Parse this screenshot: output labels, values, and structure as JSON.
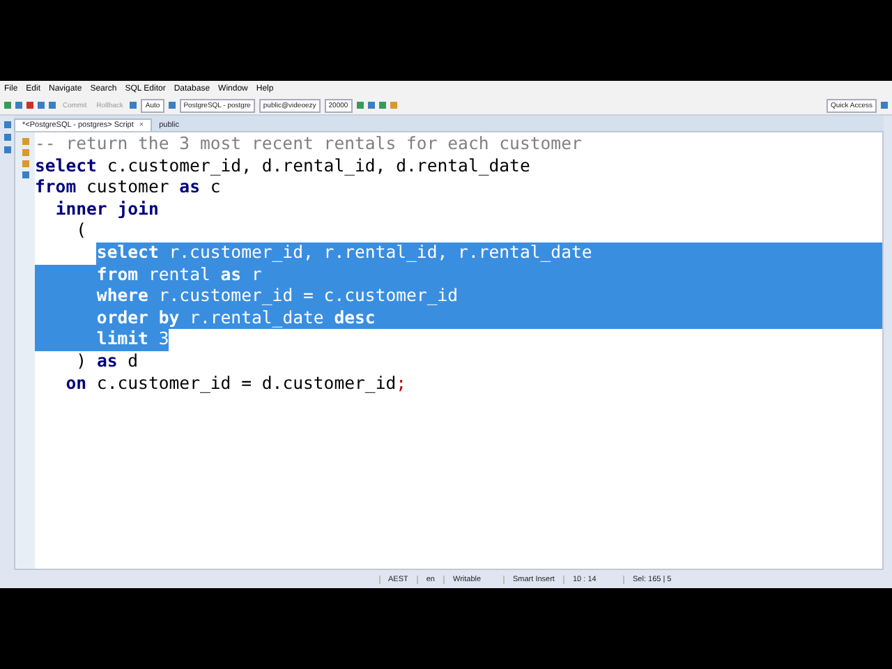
{
  "menu": [
    "File",
    "Edit",
    "Navigate",
    "Search",
    "SQL Editor",
    "Database",
    "Window",
    "Help"
  ],
  "toolbar": {
    "commit": "Commit",
    "rollback": "Rollback",
    "mode": "Auto",
    "datasource": "PostgreSQL - postgre",
    "schema": "public@videoezy",
    "limit": "20000",
    "quick_access": "Quick Access"
  },
  "tabs": [
    {
      "label": "*<PostgreSQL - postgres> Script",
      "close": "×",
      "selected": true
    },
    {
      "label": "public",
      "selected": false
    }
  ],
  "lines": [
    {
      "selected": false,
      "tokens": [
        {
          "text": "-- return the 3 most recent rentals for each customer",
          "kind": "comment"
        }
      ]
    },
    {
      "selected": false,
      "tokens": [
        {
          "text": "select",
          "kind": "keyword"
        },
        {
          "text": " c.customer_id, d.rental_id, d.rental_date",
          "kind": "plain"
        }
      ]
    },
    {
      "selected": false,
      "tokens": [
        {
          "text": "from",
          "kind": "keyword"
        },
        {
          "text": " customer ",
          "kind": "plain"
        },
        {
          "text": "as",
          "kind": "keyword"
        },
        {
          "text": " c",
          "kind": "plain"
        }
      ]
    },
    {
      "selected": false,
      "tokens": [
        {
          "text": "  inner join",
          "kind": "keyword"
        }
      ]
    },
    {
      "selected": false,
      "tokens": [
        {
          "text": "    (",
          "kind": "plain"
        }
      ]
    },
    {
      "selected": true,
      "indent_selected": false,
      "eol_selected": true,
      "tokens": [
        {
          "text": "      select",
          "kind": "keyword"
        },
        {
          "text": " r.customer_id, r.rental_id, r.rental_date",
          "kind": "plain"
        }
      ]
    },
    {
      "selected": true,
      "indent_selected": true,
      "eol_selected": true,
      "tokens": [
        {
          "text": "      from",
          "kind": "keyword"
        },
        {
          "text": " rental ",
          "kind": "plain"
        },
        {
          "text": "as",
          "kind": "keyword"
        },
        {
          "text": " r",
          "kind": "plain"
        }
      ]
    },
    {
      "selected": true,
      "indent_selected": true,
      "eol_selected": true,
      "tokens": [
        {
          "text": "      where",
          "kind": "keyword"
        },
        {
          "text": " r.customer_id = c.customer_id",
          "kind": "plain"
        }
      ]
    },
    {
      "selected": true,
      "indent_selected": true,
      "eol_selected": true,
      "tokens": [
        {
          "text": "      order by",
          "kind": "keyword"
        },
        {
          "text": " r.rental_date ",
          "kind": "plain"
        },
        {
          "text": "desc",
          "kind": "keyword"
        }
      ]
    },
    {
      "selected": true,
      "indent_selected": true,
      "eol_selected": false,
      "tokens": [
        {
          "text": "      limit",
          "kind": "keyword"
        },
        {
          "text": " 3",
          "kind": "plain"
        }
      ]
    },
    {
      "selected": false,
      "tokens": [
        {
          "text": "    ) ",
          "kind": "plain"
        },
        {
          "text": "as",
          "kind": "keyword"
        },
        {
          "text": " d",
          "kind": "plain"
        }
      ]
    },
    {
      "selected": false,
      "tokens": [
        {
          "text": "   on",
          "kind": "keyword"
        },
        {
          "text": " c.customer_id = d.customer_id",
          "kind": "plain"
        },
        {
          "text": ";",
          "kind": "punct"
        }
      ]
    }
  ],
  "status": [
    "AEST",
    "en",
    "Writable",
    "Smart Insert",
    "10 : 14",
    "Sel: 165 | 5"
  ]
}
